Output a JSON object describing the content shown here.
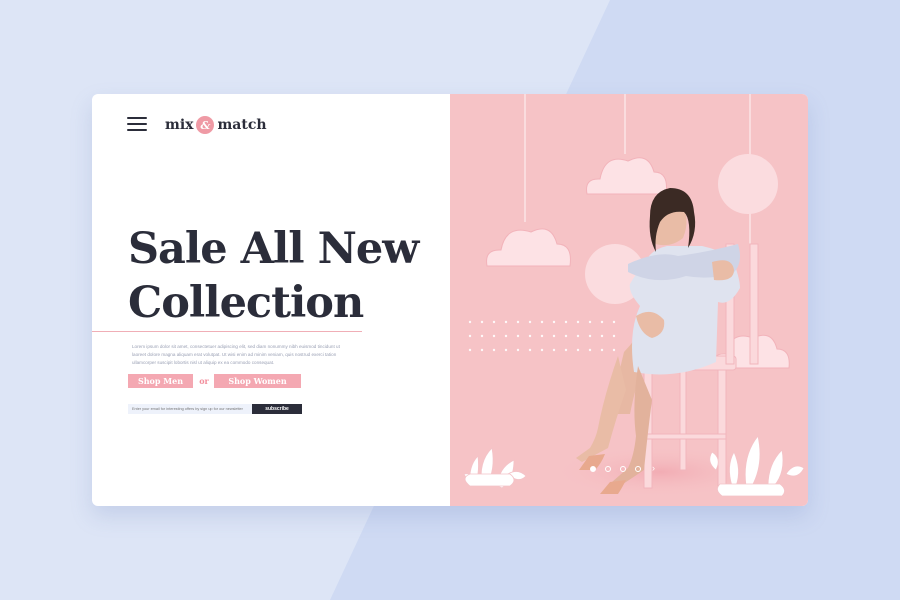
{
  "brand": {
    "name_part1": "mix",
    "ampersand": "&",
    "name_part2": "match"
  },
  "hero": {
    "headline_line1": "Sale All New",
    "headline_line2": "Collection",
    "body_text": "Lorem ipsum dolor sit amet, consectetuer adipiscing elit, sed diam nonummy nibh euismod tincidunt ut laoreet dolore magna aliquam erat volutpat. Ut wisi enim ad minim veniam, quis nostrud exerci tation ullamcorper suscipit lobortis nisl ut aliquip ex ea commodo consequat."
  },
  "actions": {
    "shop_men_label": "Shop Men",
    "or_label": "or",
    "shop_women_label": "Shop Women"
  },
  "subscribe": {
    "placeholder": "Enter your email for interesting offers by sign up for our newsletter",
    "button_label": "subscribe"
  },
  "slider": {
    "next_symbol": "›"
  },
  "colors": {
    "page_background": "#dde5f6",
    "accent_pink": "#f4a8b2",
    "dark_text": "#2b2d3a",
    "photo_background": "#f6c3c6"
  }
}
